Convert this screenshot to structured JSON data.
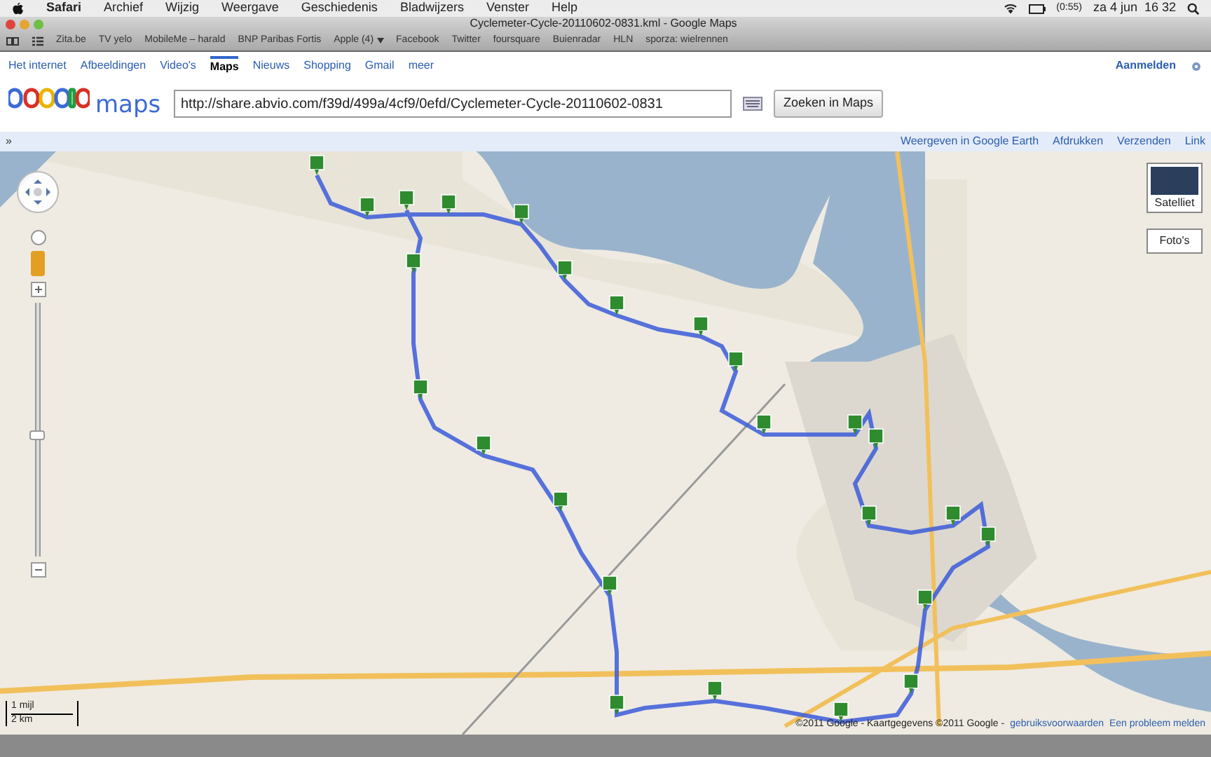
{
  "menubar": {
    "app": "Safari",
    "items": [
      "Archief",
      "Wijzig",
      "Weergave",
      "Geschiedenis",
      "Bladwijzers",
      "Venster",
      "Help"
    ],
    "battery": "(0:55)",
    "clock": "za 4 jun  16 32"
  },
  "window": {
    "title": "Cyclemeter-Cycle-20110602-0831.kml - Google Maps"
  },
  "bookmarks": [
    {
      "label": "Zita.be",
      "menu": false
    },
    {
      "label": "TV yelo",
      "menu": false
    },
    {
      "label": "MobileMe – harald",
      "menu": false
    },
    {
      "label": "BNP Paribas Fortis",
      "menu": false
    },
    {
      "label": "Apple (4)",
      "menu": true
    },
    {
      "label": "Facebook",
      "menu": false
    },
    {
      "label": "Twitter",
      "menu": false
    },
    {
      "label": "foursquare",
      "menu": false
    },
    {
      "label": "Buienradar",
      "menu": false
    },
    {
      "label": "HLN",
      "menu": false
    },
    {
      "label": "sporza: wielrennen",
      "menu": false
    }
  ],
  "google_nav": {
    "items": [
      {
        "label": "Het internet",
        "selected": false
      },
      {
        "label": "Afbeeldingen",
        "selected": false
      },
      {
        "label": "Video's",
        "selected": false
      },
      {
        "label": "Maps",
        "selected": true
      },
      {
        "label": "Nieuws",
        "selected": false
      },
      {
        "label": "Shopping",
        "selected": false
      },
      {
        "label": "Gmail",
        "selected": false
      },
      {
        "label": "meer",
        "selected": false
      }
    ],
    "sign_in": "Aanmelden"
  },
  "search": {
    "logo_word": "maps",
    "value": "http://share.abvio.com/f39d/499a/4cf9/0efd/Cyclemeter-Cycle-20110602-0831",
    "button": "Zoeken in Maps"
  },
  "toolbar": {
    "collapse": "»",
    "links": [
      "Weergeven in Google Earth",
      "Afdrukken",
      "Verzenden",
      "Link"
    ]
  },
  "map": {
    "zoom": {
      "level": 0.5
    },
    "satellite_button": "Satelliet",
    "photos_button": "Foto's",
    "scale_miles": "1 mijl",
    "scale_km": "2 km",
    "copyright": "©2011 Google - Kaartgegevens ©2011 Google -",
    "terms": "gebruiksvoorwaarden",
    "report": "Een probleem melden"
  }
}
